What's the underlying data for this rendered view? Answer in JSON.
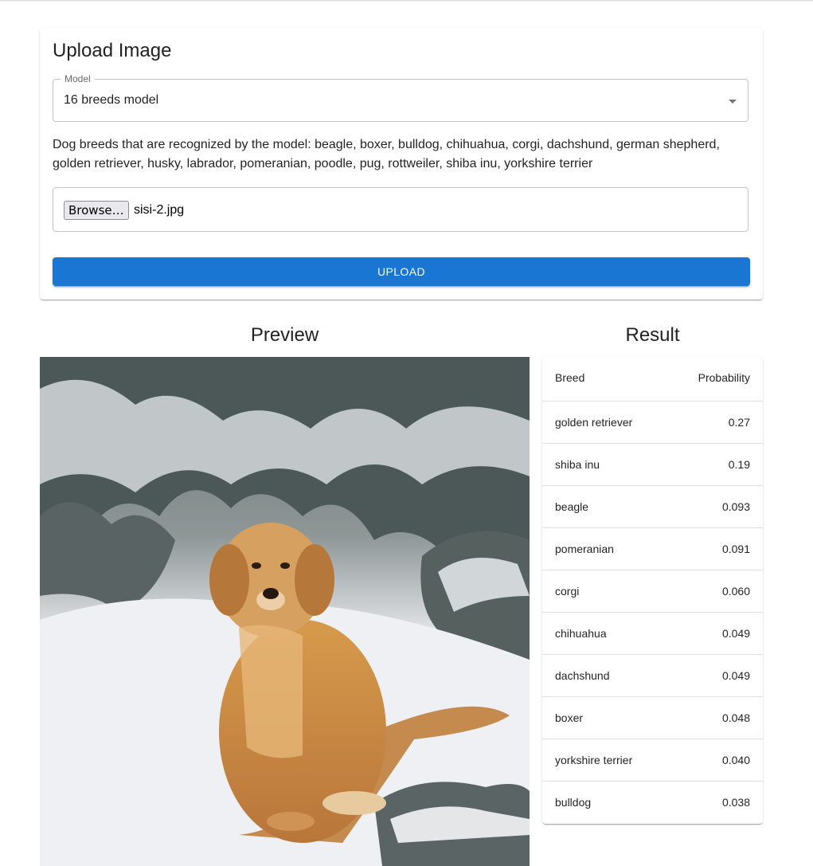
{
  "upload_card": {
    "title": "Upload Image",
    "model_label": "Model",
    "model_value": "16 breeds model",
    "breeds_text": "Dog breeds that are recognized by the model: beagle, boxer, bulldog, chihuahua, corgi, dachshund, german shepherd, golden retriever, husky, labrador, pomeranian, poodle, pug, rottweiler, shiba inu, yorkshire terrier",
    "browse_label": "Browse…",
    "file_name": "sisi-2.jpg",
    "upload_label": "UPLOAD"
  },
  "preview": {
    "title": "Preview"
  },
  "result": {
    "title": "Result",
    "columns": [
      "Breed",
      "Probability"
    ],
    "rows": [
      {
        "breed": "golden retriever",
        "probability": "0.27"
      },
      {
        "breed": "shiba inu",
        "probability": "0.19"
      },
      {
        "breed": "beagle",
        "probability": "0.093"
      },
      {
        "breed": "pomeranian",
        "probability": "0.091"
      },
      {
        "breed": "corgi",
        "probability": "0.060"
      },
      {
        "breed": "chihuahua",
        "probability": "0.049"
      },
      {
        "breed": "dachshund",
        "probability": "0.049"
      },
      {
        "breed": "boxer",
        "probability": "0.048"
      },
      {
        "breed": "yorkshire terrier",
        "probability": "0.040"
      },
      {
        "breed": "bulldog",
        "probability": "0.038"
      }
    ]
  },
  "colors": {
    "primary": "#1976d2"
  }
}
